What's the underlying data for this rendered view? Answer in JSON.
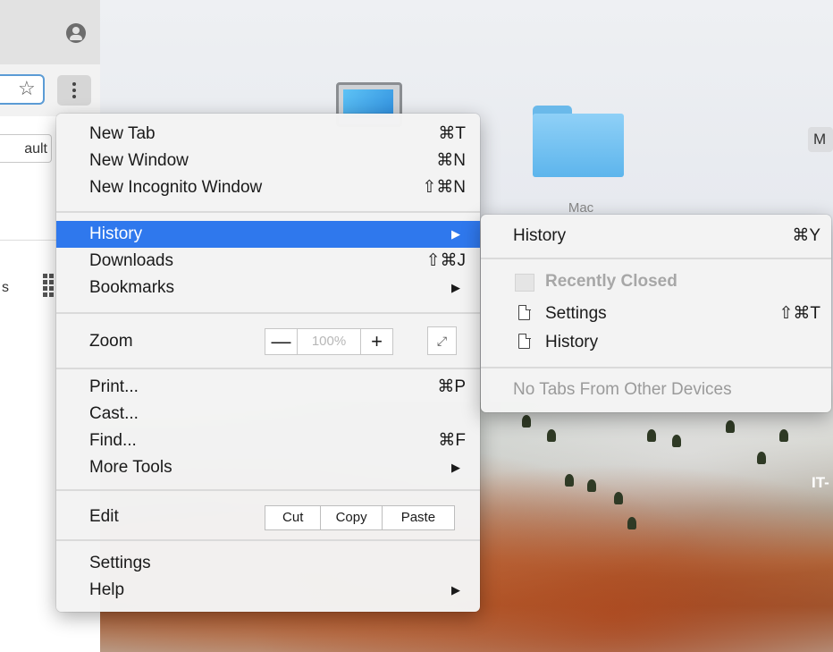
{
  "desktop": {
    "folder_label": "Mac",
    "right_edge_text": "M",
    "bottom_right_text": "IT-"
  },
  "chrome": {
    "default_button_label": "ault",
    "partial_text": "s",
    "star_icon": "star-icon",
    "menu_icon": "kebab-icon",
    "profile_icon": "profile-icon"
  },
  "menu": {
    "new_tab": {
      "label": "New Tab",
      "shortcut": "⌘T"
    },
    "new_window": {
      "label": "New Window",
      "shortcut": "⌘N"
    },
    "new_incognito": {
      "label": "New Incognito Window",
      "shortcut": "⇧⌘N"
    },
    "history": {
      "label": "History",
      "arrow": "▶"
    },
    "downloads": {
      "label": "Downloads",
      "shortcut": "⇧⌘J"
    },
    "bookmarks": {
      "label": "Bookmarks",
      "arrow": "▶"
    },
    "zoom": {
      "label": "Zoom",
      "minus": "—",
      "value": "100%",
      "plus": "+",
      "fullscreen_glyph": "⤢"
    },
    "print": {
      "label": "Print...",
      "shortcut": "⌘P"
    },
    "cast": {
      "label": "Cast..."
    },
    "find": {
      "label": "Find...",
      "shortcut": "⌘F"
    },
    "more_tools": {
      "label": "More Tools",
      "arrow": "▶"
    },
    "edit": {
      "label": "Edit",
      "cut": "Cut",
      "copy": "Copy",
      "paste": "Paste"
    },
    "settings": {
      "label": "Settings"
    },
    "help": {
      "label": "Help",
      "arrow": "▶"
    }
  },
  "history_submenu": {
    "history": {
      "label": "History",
      "shortcut": "⌘Y"
    },
    "recently_closed": "Recently Closed",
    "items": [
      {
        "label": "Settings",
        "shortcut": "⇧⌘T"
      },
      {
        "label": "History",
        "shortcut": ""
      }
    ],
    "no_tabs": "No Tabs From Other Devices"
  },
  "colors": {
    "highlight": "#2f78ed",
    "menu_bg": "#f3f3f3",
    "folder_blue": "#5db5ec"
  }
}
